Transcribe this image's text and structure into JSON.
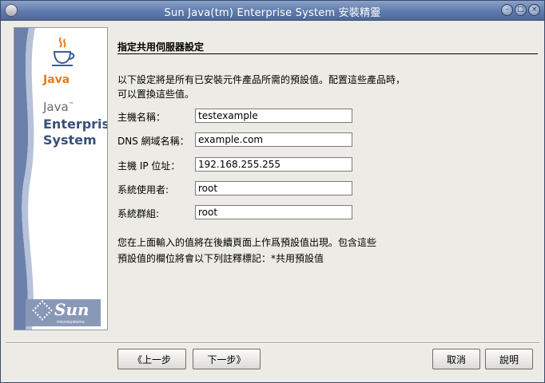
{
  "window": {
    "title": "Sun Java(tm) Enterprise System 安裝精靈",
    "controls": [
      "minimize-icon",
      "maximize-icon",
      "close-icon"
    ]
  },
  "sidebar": {
    "java_logo_text": "Java",
    "brand_line1": "Java",
    "brand_tm": "™",
    "brand_line2": "Enterprise",
    "brand_line3": "System",
    "sun_logo_text": "Sun",
    "sun_logo_sub": "microsystems"
  },
  "main": {
    "section_title": "指定共用伺服器設定",
    "intro": "以下設定將是所有已安裝元件產品所需的預設值。配置這些產品時，可以置換這些值。",
    "fields": [
      {
        "label": "主機名稱：",
        "value": "testexample"
      },
      {
        "label": "DNS 網域名稱：",
        "value": "example.com"
      },
      {
        "label": "主機 IP 位址：",
        "value": "192.168.255.255"
      },
      {
        "label": "系統使用者:",
        "value": "root"
      },
      {
        "label": "系統群組:",
        "value": "root"
      }
    ],
    "note": "您在上面輸入的值將在後續頁面上作爲預設值出現。包含這些預設值的欄位將會以下列註釋標記：*共用預設值"
  },
  "buttons": {
    "back": "《上一步",
    "next": "下一步》",
    "cancel": "取消",
    "help": "說明"
  },
  "colors": {
    "titlebar": "#5f7bab",
    "window_bg": "#ecebe6",
    "brand_blue": "#395079",
    "java_orange": "#e87a1b"
  }
}
